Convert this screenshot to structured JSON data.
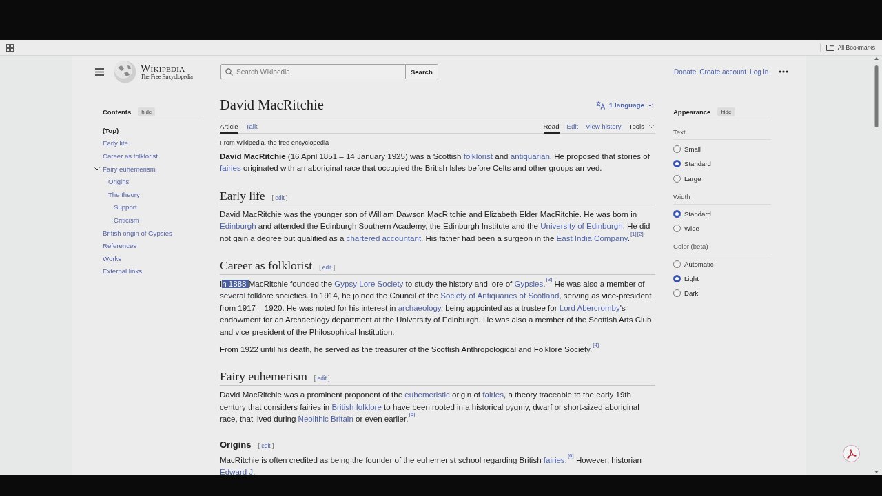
{
  "bookmarks_bar": {
    "all_bookmarks": "All Bookmarks"
  },
  "header": {
    "logo_title": "Wikipedia",
    "logo_tagline": "The Free Encyclopedia",
    "search": {
      "placeholder": "Search Wikipedia",
      "button": "Search"
    },
    "user_links": [
      "Donate",
      "Create account",
      "Log in"
    ]
  },
  "contents": {
    "title": "Contents",
    "hide": "hide",
    "items": [
      {
        "label": "(Top)",
        "selected": true
      },
      {
        "label": "Early life",
        "selected": false
      },
      {
        "label": "Career as folklorist",
        "selected": false
      },
      {
        "label": "Fairy euhemerism",
        "selected": false,
        "expanded": true,
        "children": [
          {
            "label": "Origins",
            "selected": false
          },
          {
            "label": "The theory",
            "selected": false,
            "children": [
              {
                "label": "Support",
                "selected": false
              },
              {
                "label": "Criticism",
                "selected": false
              }
            ]
          }
        ]
      },
      {
        "label": "British origin of Gypsies",
        "selected": false
      },
      {
        "label": "References",
        "selected": false
      },
      {
        "label": "Works",
        "selected": false
      },
      {
        "label": "External links",
        "selected": false
      }
    ]
  },
  "article": {
    "title": "David MacRitchie",
    "language_button": "1 language",
    "left_tabs": [
      {
        "label": "Article",
        "selected": true
      },
      {
        "label": "Talk",
        "selected": false
      }
    ],
    "right_tabs": [
      {
        "label": "Read",
        "selected": true,
        "kind": "tab"
      },
      {
        "label": "Edit",
        "selected": false,
        "kind": "tab"
      },
      {
        "label": "View history",
        "selected": false,
        "kind": "tab"
      },
      {
        "label": "Tools",
        "selected": false,
        "kind": "menu"
      }
    ],
    "tagline": "From Wikipedia, the free encyclopedia",
    "blocks": [
      {
        "kind": "p",
        "segments": [
          {
            "kind": "b",
            "text": "David MacRitchie"
          },
          {
            "kind": "t",
            "text": " (16 April 1851 – 14 January 1925) was a Scottish "
          },
          {
            "kind": "a",
            "text": "folklorist"
          },
          {
            "kind": "t",
            "text": " and "
          },
          {
            "kind": "a",
            "text": "antiquarian"
          },
          {
            "kind": "t",
            "text": ". He proposed that stories of "
          },
          {
            "kind": "a",
            "text": "fairies"
          },
          {
            "kind": "t",
            "text": " originated with an aboriginal race that occupied the British Isles before Celts and other groups arrived."
          }
        ]
      },
      {
        "kind": "h2",
        "text": "Early life",
        "edit": {
          "open": "[",
          "label": "edit",
          "close": "]"
        }
      },
      {
        "kind": "p",
        "segments": [
          {
            "kind": "t",
            "text": "David MacRitchie was the younger son of William Dawson MacRitchie and Elizabeth Elder MacRitchie. He was born in "
          },
          {
            "kind": "a",
            "text": "Edinburgh"
          },
          {
            "kind": "t",
            "text": " and attended the Edinburgh Southern Academy, the Edinburgh Institute and the "
          },
          {
            "kind": "a",
            "text": "University of Edinburgh"
          },
          {
            "kind": "t",
            "text": ". He did not gain a degree but qualified as a "
          },
          {
            "kind": "a",
            "text": "chartered accountant"
          },
          {
            "kind": "t",
            "text": ". His father had been a surgeon in the "
          },
          {
            "kind": "a",
            "text": "East India Company"
          },
          {
            "kind": "t",
            "text": "."
          },
          {
            "kind": "ref",
            "text": "[1]"
          },
          {
            "kind": "ref",
            "text": "[2]"
          }
        ]
      },
      {
        "kind": "h2",
        "text": "Career as folklorist",
        "edit": {
          "open": "[",
          "label": "edit",
          "close": "]"
        }
      },
      {
        "kind": "p",
        "segments": [
          {
            "kind": "t",
            "text": "I"
          },
          {
            "kind": "sel",
            "text": "n 1888 "
          },
          {
            "kind": "t",
            "text": "MacRitchie founded the "
          },
          {
            "kind": "a",
            "text": "Gypsy Lore Society"
          },
          {
            "kind": "t",
            "text": " to study the history and lore of "
          },
          {
            "kind": "a",
            "text": "Gypsies"
          },
          {
            "kind": "t",
            "text": "."
          },
          {
            "kind": "ref",
            "text": "[3]"
          },
          {
            "kind": "t",
            "text": " He was also a member of several folklore societies. In 1914, he joined the Council of the "
          },
          {
            "kind": "a",
            "text": "Society of Antiquaries of Scotland"
          },
          {
            "kind": "t",
            "text": ", serving as vice-president from 1917 – 1920. He was noted for his interest in "
          },
          {
            "kind": "a",
            "text": "archaeology"
          },
          {
            "kind": "t",
            "text": ", being appointed as a trustee for "
          },
          {
            "kind": "a",
            "text": "Lord Abercromby"
          },
          {
            "kind": "t",
            "text": "'s endowment for an Archaeology department at the University of Edinburgh. He was also a member of the Scottish Arts Club and vice-president of the Philosophical Institution."
          }
        ]
      },
      {
        "kind": "p",
        "segments": [
          {
            "kind": "t",
            "text": "From 1922 until his death, he served as the treasurer of the Scottish Anthropological and Folklore Society."
          },
          {
            "kind": "ref",
            "text": "[4]"
          }
        ]
      },
      {
        "kind": "h2",
        "text": "Fairy euhemerism",
        "edit": {
          "open": "[",
          "label": "edit",
          "close": "]"
        }
      },
      {
        "kind": "p",
        "segments": [
          {
            "kind": "t",
            "text": "David MacRitchie was a prominent proponent of the "
          },
          {
            "kind": "a",
            "text": "euhemeristic"
          },
          {
            "kind": "t",
            "text": " origin of "
          },
          {
            "kind": "a",
            "text": "fairies"
          },
          {
            "kind": "t",
            "text": ", a theory traceable to the early 19th century that considers fairies in "
          },
          {
            "kind": "a",
            "text": "British folklore"
          },
          {
            "kind": "t",
            "text": " to have been rooted in a historical pygmy, dwarf or short-sized aboriginal race, that lived during "
          },
          {
            "kind": "a",
            "text": "Neolithic Britain"
          },
          {
            "kind": "t",
            "text": " or even earlier."
          },
          {
            "kind": "ref",
            "text": "[5]"
          }
        ]
      },
      {
        "kind": "h3",
        "text": "Origins",
        "edit": {
          "open": "[",
          "label": "edit",
          "close": "]"
        }
      },
      {
        "kind": "p",
        "segments": [
          {
            "kind": "t",
            "text": "MacRitchie is often credited as being the founder of the euhemerist school regarding British "
          },
          {
            "kind": "a",
            "text": "fairies"
          },
          {
            "kind": "t",
            "text": "."
          },
          {
            "kind": "ref",
            "text": "[6]"
          },
          {
            "kind": "t",
            "text": " However, historian "
          },
          {
            "kind": "a",
            "text": "Edward J."
          }
        ]
      }
    ]
  },
  "appearance": {
    "title": "Appearance",
    "hide": "hide",
    "groups": [
      {
        "label": "Text",
        "options": [
          {
            "label": "Small",
            "selected": false
          },
          {
            "label": "Standard",
            "selected": true
          },
          {
            "label": "Large",
            "selected": false
          }
        ]
      },
      {
        "label": "Width",
        "options": [
          {
            "label": "Standard",
            "selected": true
          },
          {
            "label": "Wide",
            "selected": false
          }
        ]
      },
      {
        "label": "Color (beta)",
        "options": [
          {
            "label": "Automatic",
            "selected": false
          },
          {
            "label": "Light",
            "selected": true
          },
          {
            "label": "Dark",
            "selected": false
          }
        ]
      }
    ]
  }
}
